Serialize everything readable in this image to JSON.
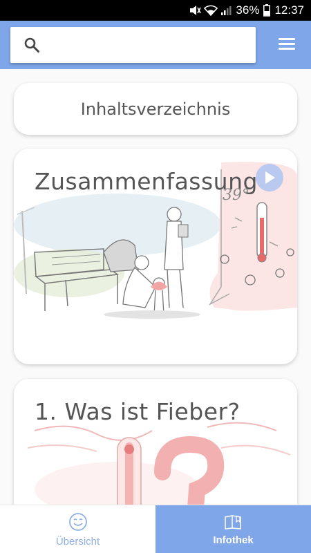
{
  "status_bar": {
    "battery": "36%",
    "time": "12:37"
  },
  "search": {
    "value": "",
    "placeholder": ""
  },
  "toc": {
    "label": "Inhaltsverzeichnis"
  },
  "cards": [
    {
      "title": "Zusammenfassung",
      "has_video": true,
      "thermometer_text": "39°"
    },
    {
      "title": "1.  Was ist Fieber?",
      "has_video": false
    }
  ],
  "bottom_nav": [
    {
      "label": "Übersicht",
      "icon": "smiley-icon",
      "active": false
    },
    {
      "label": "Infothek",
      "icon": "book-icon",
      "active": true
    }
  ],
  "colors": {
    "accent": "#7fa6e8",
    "inactive_nav_text": "#8fb0e4",
    "play_button": "#b9c9ef"
  }
}
